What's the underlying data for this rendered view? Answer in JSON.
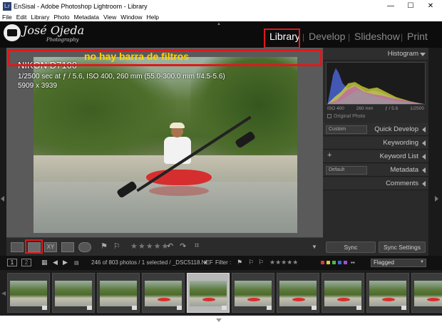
{
  "window": {
    "title": "EnSisal - Adobe Photoshop Lightroom - Library",
    "controls": [
      "minimize-icon",
      "maximize-icon",
      "close-icon"
    ]
  },
  "menu": [
    "File",
    "Edit",
    "Library",
    "Photo",
    "Metadata",
    "View",
    "Window",
    "Help"
  ],
  "identity": {
    "name": "José Ojeda",
    "sub": "Photography"
  },
  "modules": [
    "Library",
    "Develop",
    "Slideshow",
    "Print"
  ],
  "active_module": "Library",
  "annotation": {
    "text": "no hay barra de filtros",
    "color": "#ffd400",
    "box_color": "#e0181b"
  },
  "photo_info": {
    "camera": "NIKON D7100",
    "exif": "1/2500 sec at ƒ / 5.6, ISO 400, 260 mm (55.0-300.0 mm f/4.5-5.6)",
    "dimensions": "5909 x 3939"
  },
  "toolbar": {
    "view_icons": [
      "grid-view-icon",
      "loupe-view-icon",
      "compare-view-icon",
      "survey-view-icon",
      "people-view-icon"
    ],
    "compare_label": "XY",
    "stars": "★★★★★"
  },
  "right_panel": {
    "histogram": {
      "title": "Histogram",
      "iso": "ISO 400",
      "focal": "260 mm",
      "aperture": "ƒ / 5.6",
      "shutter": "1/2500",
      "original_photo": "Original Photo"
    },
    "quick_develop": {
      "title": "Quick Develop",
      "preset": "Custom"
    },
    "keywording": "Keywording",
    "keyword_list": {
      "title": "Keyword List",
      "plus": "+"
    },
    "metadata": {
      "title": "Metadata",
      "preset": "Default"
    },
    "comments": "Comments",
    "sync": "Sync",
    "sync_settings": "Sync Settings"
  },
  "filmstrip_bar": {
    "monitor1": "1",
    "monitor2": "2",
    "status": "246 of 803 photos / 1 selected / _DSC5118.NEF",
    "filter_label": "Filter :",
    "filter_stars": "★★★★★",
    "filter_value": "Flagged",
    "label_colors": [
      "#d63a3a",
      "#e0c73a",
      "#4fb84f",
      "#3a6bd6",
      "#9a4fd6"
    ]
  },
  "filmstrip": {
    "thumbnails": [
      {
        "kayak": false,
        "selected": false
      },
      {
        "kayak": false,
        "selected": false
      },
      {
        "kayak": false,
        "selected": false
      },
      {
        "kayak": true,
        "selected": false
      },
      {
        "kayak": true,
        "selected": true
      },
      {
        "kayak": true,
        "selected": false
      },
      {
        "kayak": true,
        "selected": false
      },
      {
        "kayak": true,
        "selected": false
      },
      {
        "kayak": true,
        "selected": false
      },
      {
        "kayak": true,
        "selected": false
      }
    ]
  }
}
